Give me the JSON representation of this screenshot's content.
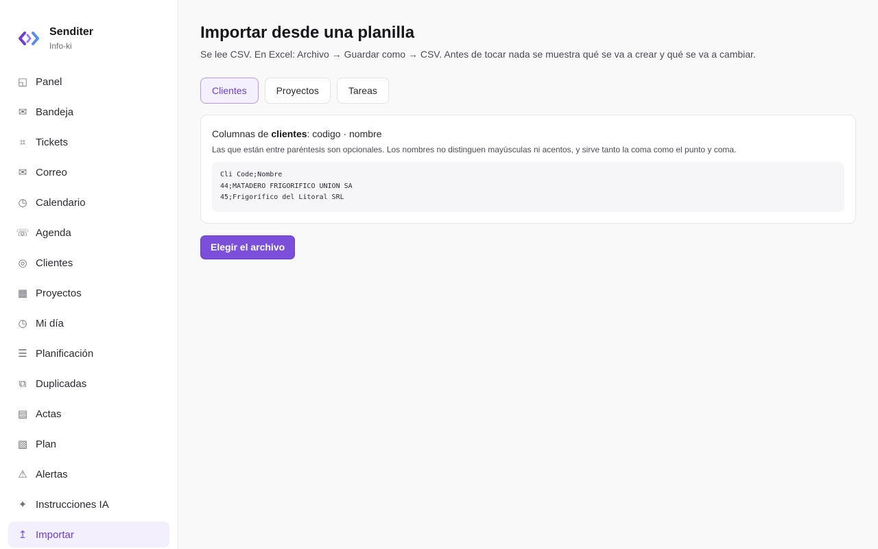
{
  "brand": {
    "name": "Senditer",
    "subtitle": "Info-ki"
  },
  "nav": [
    {
      "label": "Panel",
      "icon": "panel-icon",
      "glyph": "◱"
    },
    {
      "label": "Bandeja",
      "icon": "inbox-icon",
      "glyph": "✉"
    },
    {
      "label": "Tickets",
      "icon": "tickets-icon",
      "glyph": "⌗"
    },
    {
      "label": "Correo",
      "icon": "mail-icon",
      "glyph": "✉"
    },
    {
      "label": "Calendario",
      "icon": "calendar-icon",
      "glyph": "◷"
    },
    {
      "label": "Agenda",
      "icon": "phone-icon",
      "glyph": "☏"
    },
    {
      "label": "Clientes",
      "icon": "clients-icon",
      "glyph": "◎"
    },
    {
      "label": "Proyectos",
      "icon": "projects-icon",
      "glyph": "▦"
    },
    {
      "label": "Mi día",
      "icon": "clock-icon",
      "glyph": "◷"
    },
    {
      "label": "Planificación",
      "icon": "list-icon",
      "glyph": "☰"
    },
    {
      "label": "Duplicadas",
      "icon": "duplicate-icon",
      "glyph": "⧉"
    },
    {
      "label": "Actas",
      "icon": "document-icon",
      "glyph": "▤"
    },
    {
      "label": "Plan",
      "icon": "plan-icon",
      "glyph": "▧"
    },
    {
      "label": "Alertas",
      "icon": "alert-icon",
      "glyph": "⚠"
    },
    {
      "label": "Instrucciones IA",
      "icon": "sparkle-icon",
      "glyph": "✦"
    },
    {
      "label": "Importar",
      "icon": "import-icon",
      "glyph": "↥",
      "active": true
    }
  ],
  "page": {
    "title": "Importar desde una planilla",
    "subtitle": "Se lee CSV. En Excel: Archivo → Guardar como → CSV. Antes de tocar nada se muestra qué se va a crear y qué se va a cambiar."
  },
  "tabs": [
    {
      "label": "Clientes",
      "active": true
    },
    {
      "label": "Proyectos"
    },
    {
      "label": "Tareas"
    }
  ],
  "card": {
    "heading_prefix": "Columnas de ",
    "heading_entity": "clientes",
    "heading_columns": ": codigo · nombre",
    "note": "Las que están entre paréntesis son opcionales. Los nombres no distinguen mayúsculas ni acentos, y sirve tanto la coma como el punto y coma.",
    "example_lines": [
      "Cli Code;Nombre",
      "44;MATADERO FRIGORIFICO UNION SA",
      "45;Frigorífico del Litoral SRL"
    ]
  },
  "actions": {
    "choose_file_label": "Elegir el archivo"
  },
  "colors": {
    "accent": "#7b4fd9",
    "active_bg": "#f3effd",
    "page_bg": "#f9f9fa"
  }
}
